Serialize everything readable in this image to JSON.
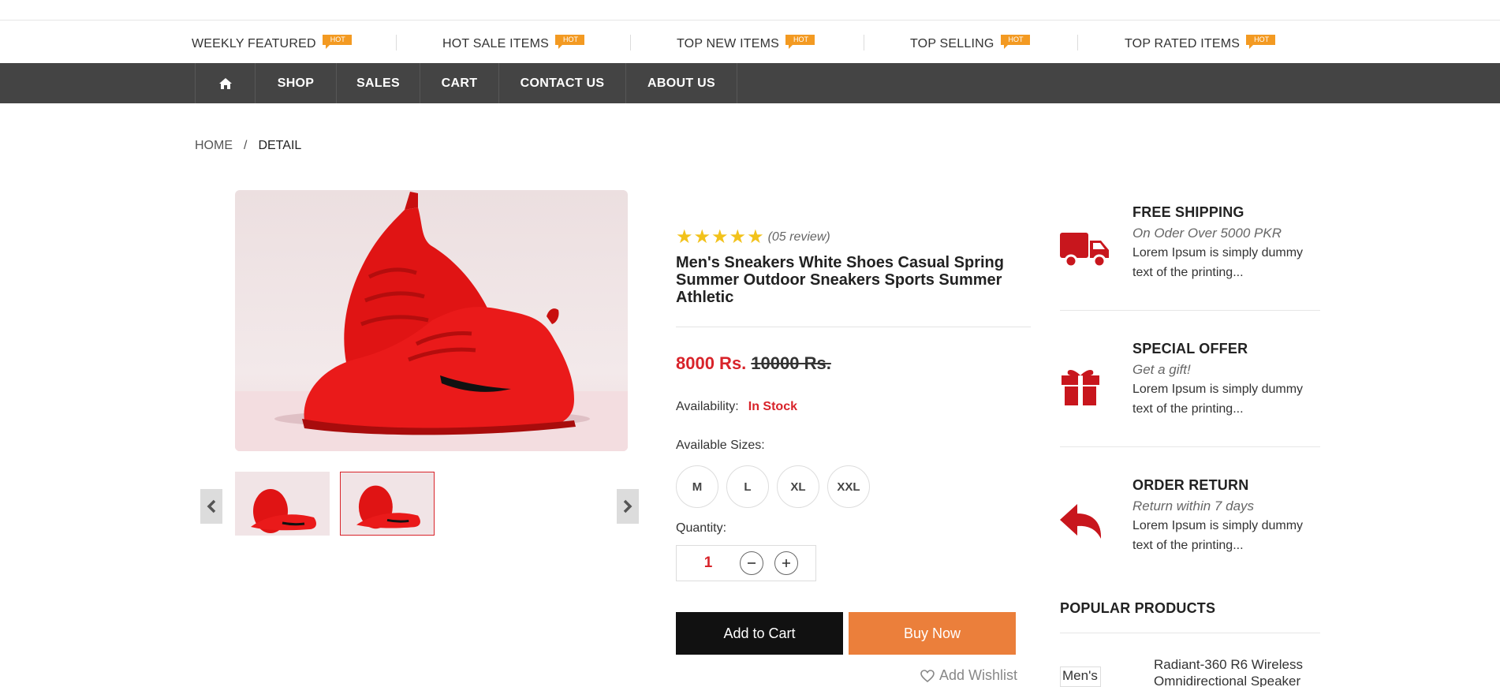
{
  "featured": [
    {
      "label": "WEEKLY FEATURED",
      "badge": "HOT"
    },
    {
      "label": "HOT SALE ITEMS",
      "badge": "HOT"
    },
    {
      "label": "TOP NEW ITEMS",
      "badge": "HOT"
    },
    {
      "label": "TOP SELLING",
      "badge": "HOT"
    },
    {
      "label": "TOP RATED ITEMS",
      "badge": "HOT"
    }
  ],
  "nav": {
    "home_icon": "home-icon",
    "items": [
      "SHOP",
      "SALES",
      "CART",
      "CONTACT US",
      "ABOUT US"
    ]
  },
  "breadcrumb": {
    "home": "HOME",
    "separator": "/",
    "current": "DETAIL"
  },
  "product": {
    "rating_stars": 5,
    "review_text": "(05 review)",
    "title": "Men's Sneakers White Shoes Casual Spring Summer Outdoor Sneakers Sports Summer Athletic",
    "price_new": "8000 Rs.",
    "price_old": "10000 Rs.",
    "availability_label": "Availability:",
    "availability_value": "In Stock",
    "sizes_label": "Available Sizes:",
    "sizes": [
      "M",
      "L",
      "XL",
      "XXL"
    ],
    "quantity_label": "Quantity:",
    "quantity": "1",
    "add_to_cart": "Add to Cart",
    "buy_now": "Buy Now",
    "wishlist": "Add Wishlist"
  },
  "features": [
    {
      "title": "FREE SHIPPING",
      "subtitle": "On Oder Over 5000 PKR",
      "desc": "Lorem Ipsum is simply dummy text of the printing...",
      "icon": "truck-icon"
    },
    {
      "title": "SPECIAL OFFER",
      "subtitle": "Get a gift!",
      "desc": "Lorem Ipsum is simply dummy text of the printing...",
      "icon": "gift-icon"
    },
    {
      "title": "ORDER RETURN",
      "subtitle": "Return within 7 days",
      "desc": "Lorem Ipsum is simply dummy text of the printing...",
      "icon": "return-icon"
    }
  ],
  "popular": {
    "title": "POPULAR PRODUCTS",
    "items": [
      {
        "thumb_alt": "Men's",
        "name": "Radiant-360 R6 Wireless Omnidirectional Speaker"
      }
    ]
  },
  "colors": {
    "accent_red": "#d8232a",
    "hot_orange": "#f39a22",
    "buy_orange": "#eb7f3b",
    "nav_bg": "#444444",
    "star": "#f2c21b"
  }
}
